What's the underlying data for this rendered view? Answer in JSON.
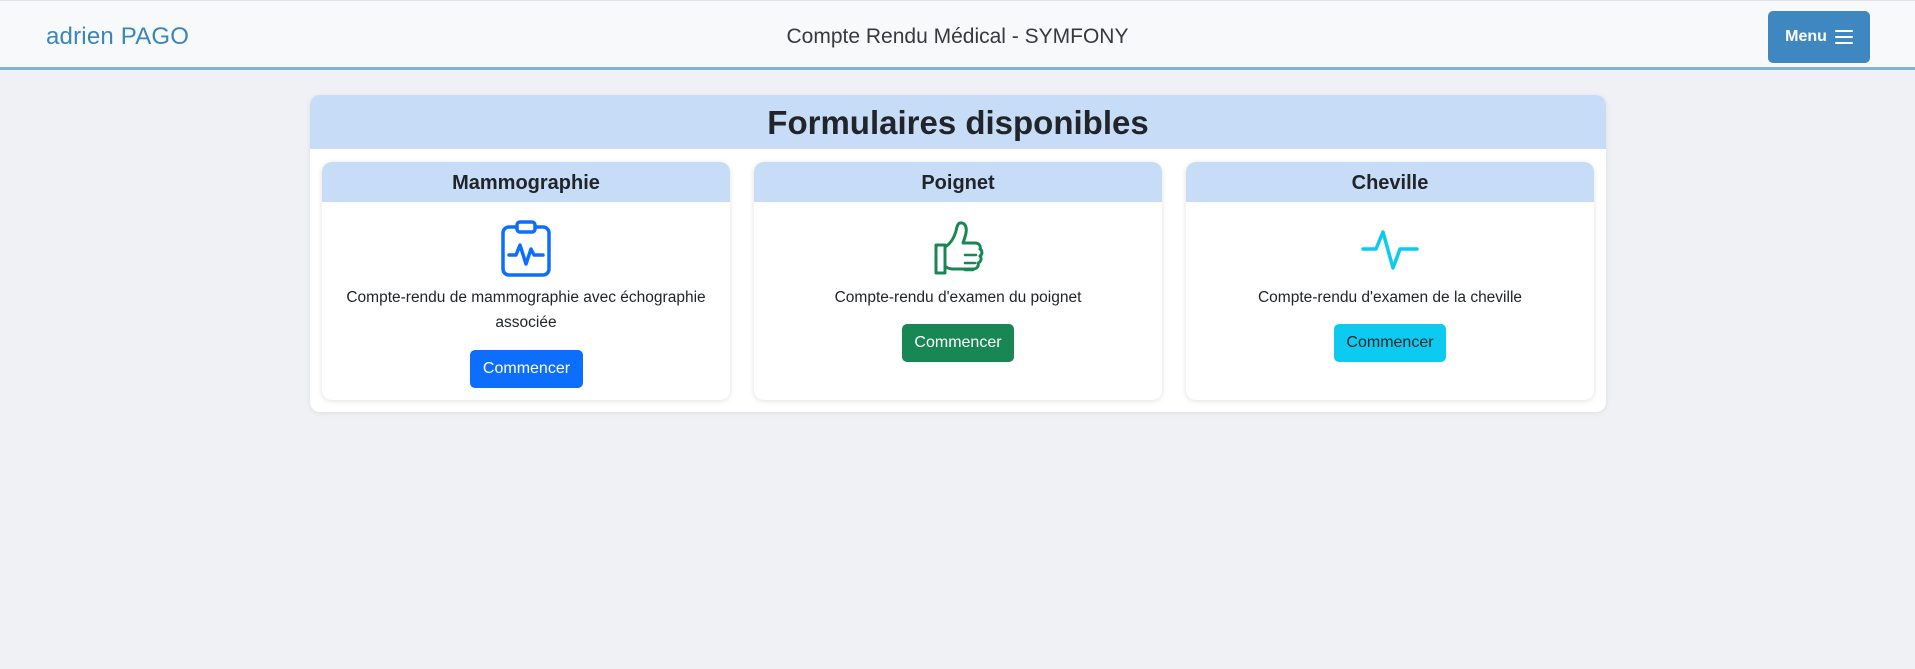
{
  "navbar": {
    "brand": "adrien PAGO",
    "title": "Compte Rendu Médical - SYMFONY",
    "menu_label": "Menu"
  },
  "panel": {
    "title": "Formulaires disponibles"
  },
  "cards": [
    {
      "title": "Mammographie",
      "icon": "clipboard-pulse-icon",
      "description": "Compte-rendu de mammographie avec échographie associée",
      "button_label": "Commencer",
      "color": "#0d6efd"
    },
    {
      "title": "Poignet",
      "icon": "thumbs-up-icon",
      "description": "Compte-rendu d'examen du poignet",
      "button_label": "Commencer",
      "color": "#198754"
    },
    {
      "title": "Cheville",
      "icon": "pulse-icon",
      "description": "Compte-rendu d'examen de la cheville",
      "button_label": "Commencer",
      "color": "#0dcaf0"
    }
  ],
  "colors": {
    "accent": "#3e87c0",
    "header_bg": "#c7dcf6",
    "page_bg": "#eff1f5"
  }
}
